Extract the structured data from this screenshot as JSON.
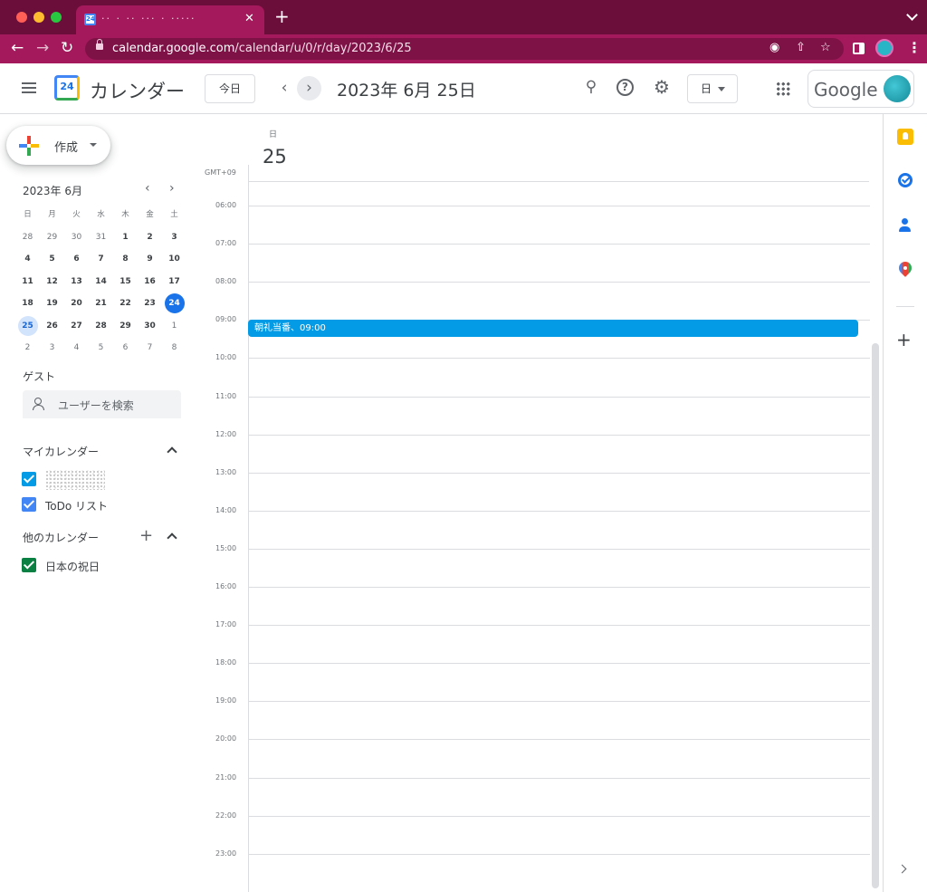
{
  "browser": {
    "tab_title": "·· · ·· ··· · ·····",
    "tab_close": "✕",
    "new_tab": "+",
    "url_host": "calendar.google.com",
    "url_path": "/calendar/u/0/r/day/2023/6/25",
    "favicon_number": "24"
  },
  "header": {
    "logo_number": "24",
    "app_name": "カレンダー",
    "today_label": "今日",
    "prev_glyph": "‹",
    "next_glyph": "›",
    "date_title": "2023年 6月 25日",
    "view_label": "日",
    "google_word": "Google",
    "help_glyph": "?"
  },
  "sidebar": {
    "create_label": "作成",
    "mini_cal": {
      "title": "2023年 6月",
      "prev": "‹",
      "next": "›",
      "weekdays": [
        "日",
        "月",
        "火",
        "水",
        "木",
        "金",
        "土"
      ],
      "weeks": [
        [
          "28",
          "29",
          "30",
          "31",
          "1",
          "2",
          "3"
        ],
        [
          "4",
          "5",
          "6",
          "7",
          "8",
          "9",
          "10"
        ],
        [
          "11",
          "12",
          "13",
          "14",
          "15",
          "16",
          "17"
        ],
        [
          "18",
          "19",
          "20",
          "21",
          "22",
          "23",
          "24"
        ],
        [
          "25",
          "26",
          "27",
          "28",
          "29",
          "30",
          "1"
        ],
        [
          "2",
          "3",
          "4",
          "5",
          "6",
          "7",
          "8"
        ]
      ]
    },
    "guests_title": "ゲスト",
    "guest_placeholder": "ユーザーを検索",
    "my_calendars_title": "マイカレンダー",
    "todo_label": "ToDo リスト",
    "other_calendars_title": "他のカレンダー",
    "holidays_label": "日本の祝日",
    "plus_glyph": "+"
  },
  "colors": {
    "my_calendar": "#039be5",
    "todo": "#4285f4",
    "holidays": "#0b8043",
    "event": "#039be5",
    "accent": "#1a73e8"
  },
  "day_view": {
    "weekday": "日",
    "day_number": "25",
    "timezone": "GMT+09",
    "hours": [
      "06:00",
      "07:00",
      "08:00",
      "09:00",
      "10:00",
      "11:00",
      "12:00",
      "13:00",
      "14:00",
      "15:00",
      "16:00",
      "17:00",
      "18:00",
      "19:00",
      "20:00",
      "21:00",
      "22:00",
      "23:00"
    ],
    "event_label": "朝礼当番、09:00"
  },
  "side_panel": {
    "add_glyph": "+",
    "icons": [
      "keep-icon",
      "tasks-icon",
      "contacts-icon",
      "maps-icon"
    ]
  }
}
